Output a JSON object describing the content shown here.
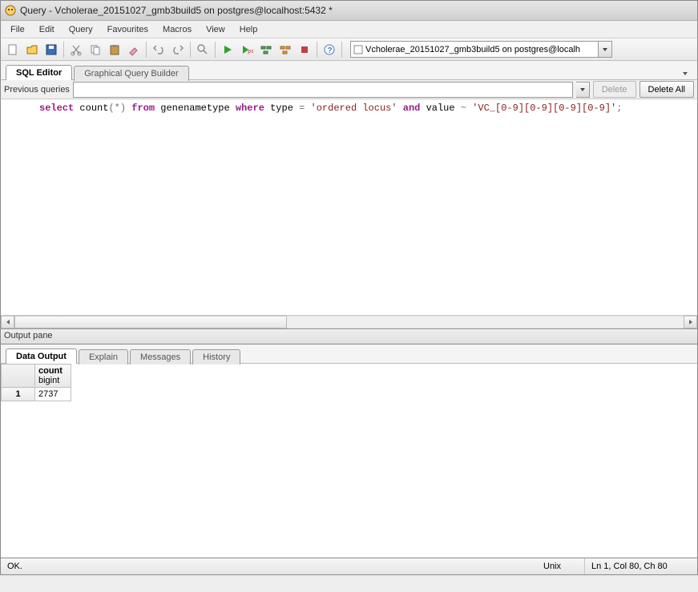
{
  "title": "Query - Vcholerae_20151027_gmb3build5 on postgres@localhost:5432 *",
  "menu": [
    "File",
    "Edit",
    "Query",
    "Favourites",
    "Macros",
    "View",
    "Help"
  ],
  "db_selector": "Vcholerae_20151027_gmb3build5 on postgres@localh",
  "tabs": {
    "sql_editor": "SQL Editor",
    "gqb": "Graphical Query Builder"
  },
  "prev_queries": {
    "label": "Previous queries",
    "delete": "Delete",
    "delete_all": "Delete All"
  },
  "sql": {
    "kw_select": "select",
    "fn_count": "count",
    "star": "(*)",
    "kw_from": "from",
    "tbl": "genenametype",
    "kw_where": "where",
    "col_type": "type",
    "eq": "=",
    "lit_type": "'ordered locus'",
    "kw_and": "and",
    "col_value": "value",
    "tilde": "~",
    "lit_regex": "'VC_[0-9][0-9][0-9][0-9]'",
    "semi": ";"
  },
  "output": {
    "pane_label": "Output pane",
    "tabs": {
      "data_output": "Data Output",
      "explain": "Explain",
      "messages": "Messages",
      "history": "History"
    },
    "col_header_1": "count",
    "col_header_2": "bigint",
    "row_label": "1",
    "value": "2737"
  },
  "status": {
    "ok": "OK.",
    "encoding": "Unix",
    "position": "Ln 1, Col 80, Ch 80"
  }
}
